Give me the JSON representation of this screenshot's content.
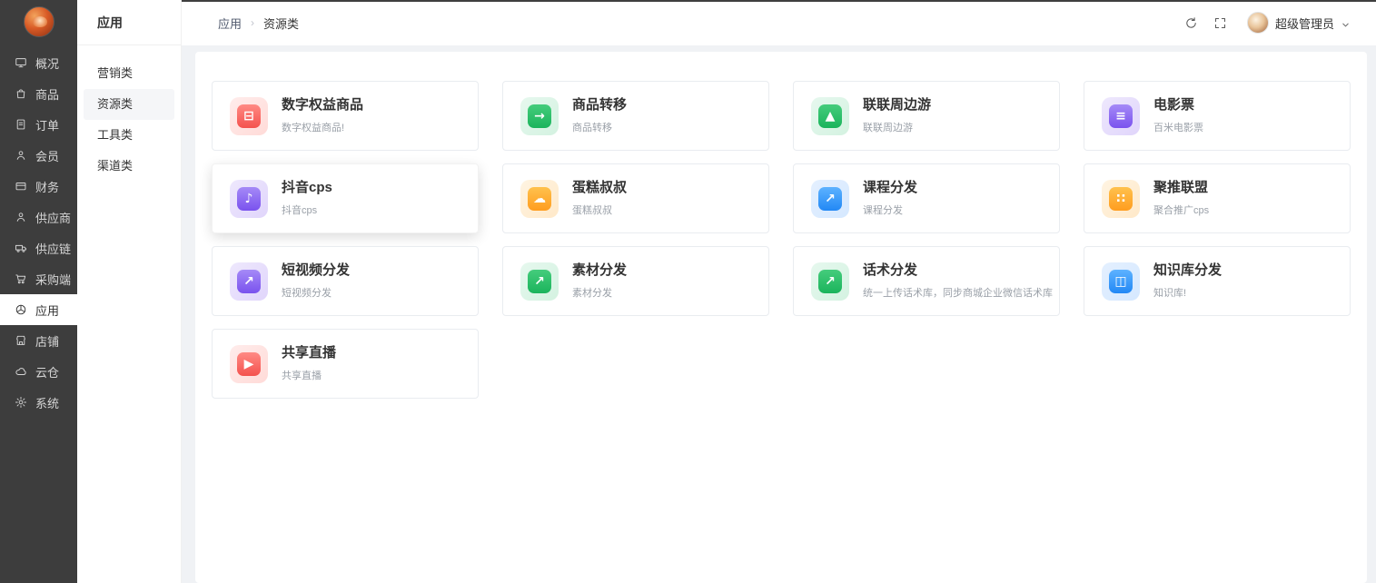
{
  "sidebar": {
    "items": [
      {
        "label": "概况",
        "icon": "dashboard-icon"
      },
      {
        "label": "商品",
        "icon": "goods-icon"
      },
      {
        "label": "订单",
        "icon": "orders-icon"
      },
      {
        "label": "会员",
        "icon": "members-icon"
      },
      {
        "label": "财务",
        "icon": "finance-icon"
      },
      {
        "label": "供应商",
        "icon": "supplier-icon"
      },
      {
        "label": "供应链",
        "icon": "supply-chain-icon"
      },
      {
        "label": "采购端",
        "icon": "procurement-icon"
      },
      {
        "label": "应用",
        "icon": "apps-icon",
        "selected": true
      },
      {
        "label": "店铺",
        "icon": "shop-icon"
      },
      {
        "label": "云仓",
        "icon": "cloud-warehouse-icon"
      },
      {
        "label": "系统",
        "icon": "system-icon"
      }
    ]
  },
  "submenu": {
    "title": "应用",
    "items": [
      {
        "label": "营销类"
      },
      {
        "label": "资源类",
        "selected": true
      },
      {
        "label": "工具类"
      },
      {
        "label": "渠道类"
      }
    ]
  },
  "header": {
    "breadcrumb": [
      "应用",
      "资源类"
    ],
    "separator": "›",
    "user": {
      "name": "超级管理员"
    }
  },
  "cards": [
    {
      "title": "数字权益商品",
      "subtitle": "数字权益商品!",
      "icon": "digital-rights-goods-icon",
      "glyph": "⊟",
      "color": "red"
    },
    {
      "title": "商品转移",
      "subtitle": "商品转移",
      "icon": "goods-transfer-icon",
      "glyph": "→",
      "color": "green"
    },
    {
      "title": "联联周边游",
      "subtitle": "联联周边游",
      "icon": "lianlian-travel-icon",
      "glyph": "▲",
      "color": "green"
    },
    {
      "title": "电影票",
      "subtitle": "百米电影票",
      "icon": "movie-ticket-icon",
      "glyph": "≡",
      "color": "purple"
    },
    {
      "title": "抖音cps",
      "subtitle": "抖音cps",
      "icon": "douyin-cps-icon",
      "glyph": "♪",
      "color": "purple",
      "elevated": true
    },
    {
      "title": "蛋糕叔叔",
      "subtitle": "蛋糕叔叔",
      "icon": "cake-uncle-icon",
      "glyph": "☁",
      "color": "orange"
    },
    {
      "title": "课程分发",
      "subtitle": "课程分发",
      "icon": "course-distribution-icon",
      "glyph": "↗",
      "color": "blue"
    },
    {
      "title": "聚推联盟",
      "subtitle": "聚合推广cps",
      "icon": "jutui-alliance-icon",
      "glyph": "∷",
      "color": "orange"
    },
    {
      "title": "短视频分发",
      "subtitle": "短视频分发",
      "icon": "short-video-distribution-icon",
      "glyph": "↗",
      "color": "purple"
    },
    {
      "title": "素材分发",
      "subtitle": "素材分发",
      "icon": "material-distribution-icon",
      "glyph": "↗",
      "color": "green"
    },
    {
      "title": "话术分发",
      "subtitle": "统一上传话术库，同步商城企业微信话术库",
      "icon": "script-distribution-icon",
      "glyph": "↗",
      "color": "green"
    },
    {
      "title": "知识库分发",
      "subtitle": "知识库!",
      "icon": "knowledge-base-icon",
      "glyph": "◫",
      "color": "blue"
    },
    {
      "title": "共享直播",
      "subtitle": "共享直播",
      "icon": "shared-live-icon",
      "glyph": "▶",
      "color": "red"
    }
  ],
  "colors": {
    "red": "#f4524e",
    "green": "#1bb45c",
    "purple": "#7a52ee",
    "blue": "#2288f5",
    "orange": "#ff9d1f",
    "sidebar_bg": "#3d3d3d",
    "page_bg": "#f0f2f5"
  }
}
